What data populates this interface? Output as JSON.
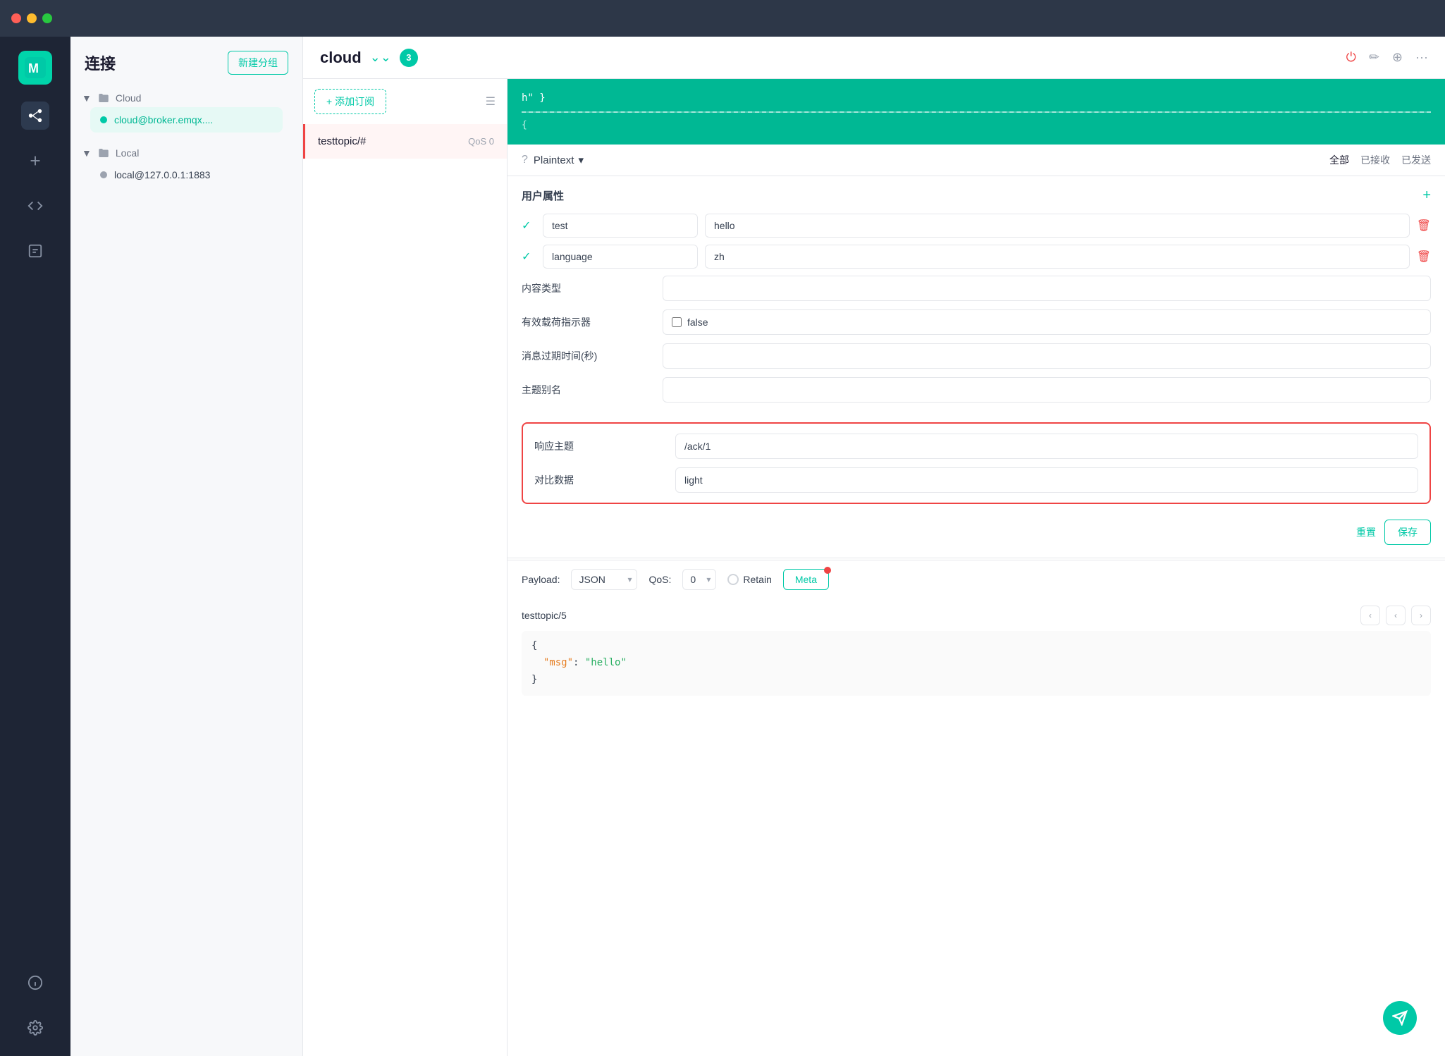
{
  "titlebar": {
    "traffic_lights": [
      "red",
      "yellow",
      "green"
    ]
  },
  "sidebar": {
    "logo_alt": "MQTTX logo",
    "icons": [
      {
        "name": "connections-icon",
        "label": "Connections",
        "active": false
      },
      {
        "name": "add-icon",
        "label": "Add",
        "active": false
      },
      {
        "name": "script-icon",
        "label": "Script",
        "active": false
      },
      {
        "name": "log-icon",
        "label": "Log",
        "active": false
      }
    ],
    "bottom_icons": [
      {
        "name": "info-icon",
        "label": "Info"
      },
      {
        "name": "settings-icon",
        "label": "Settings"
      }
    ]
  },
  "connection_panel": {
    "title": "连接",
    "new_group_btn": "新建分组",
    "groups": [
      {
        "name": "Cloud",
        "items": [
          {
            "label": "cloud@broker.emqx....",
            "active": true,
            "connected": true
          }
        ]
      },
      {
        "name": "Local",
        "items": [
          {
            "label": "local@127.0.0.1:1883",
            "active": false,
            "connected": false
          }
        ]
      }
    ]
  },
  "main": {
    "topbar": {
      "title": "cloud",
      "badge": "3",
      "actions": {
        "power": "⏻",
        "edit": "✏",
        "add": "+",
        "more": "···"
      }
    },
    "subscriptions": {
      "add_btn": "+ 添加订阅",
      "items": [
        {
          "topic": "testtopic/#",
          "qos": "QoS 0",
          "active": true
        }
      ]
    },
    "filter_bar": {
      "format": "Plaintext",
      "options": [
        "全部",
        "已接收",
        "已发送"
      ]
    },
    "message_display": {
      "line1": "h\" }",
      "line2": "{"
    },
    "user_properties": {
      "section_title": "用户属性",
      "rows": [
        {
          "key": "test",
          "value": "hello",
          "checked": true
        },
        {
          "key": "language",
          "value": "zh",
          "checked": true
        }
      ]
    },
    "form_fields": [
      {
        "label": "内容类型",
        "value": "",
        "type": "text"
      },
      {
        "label": "有效载荷指示器",
        "value": "false",
        "type": "checkbox"
      },
      {
        "label": "消息过期时间(秒)",
        "value": "",
        "type": "text"
      },
      {
        "label": "主题别名",
        "value": "",
        "type": "text"
      }
    ],
    "highlight_fields": [
      {
        "label": "响应主题",
        "value": "/ack/1",
        "type": "text"
      },
      {
        "label": "对比数据",
        "value": "light",
        "type": "text"
      }
    ],
    "actions": {
      "reset": "重置",
      "save": "保存"
    },
    "publisher": {
      "payload_label": "Payload:",
      "payload_format": "JSON",
      "qos_label": "QoS:",
      "qos_value": "0",
      "retain_label": "Retain",
      "meta_btn": "Meta",
      "topic": "testtopic/5",
      "code_lines": [
        "{",
        "  \"msg\": \"hello\"",
        "}"
      ],
      "nav_prev": "‹",
      "nav_prev2": "‹",
      "nav_next": "›"
    }
  }
}
